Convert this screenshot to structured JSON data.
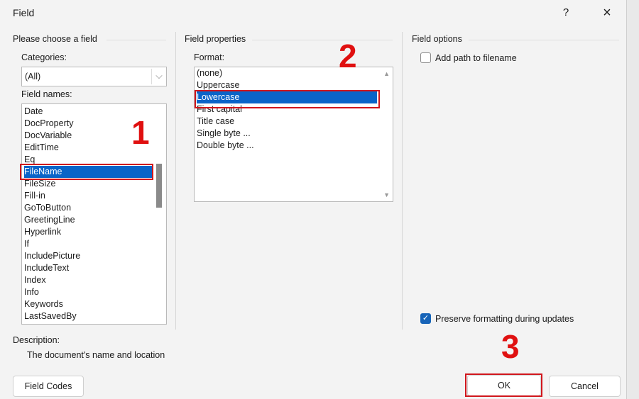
{
  "window": {
    "title": "Field",
    "help_label": "?",
    "close_label": "×"
  },
  "left": {
    "group_label": "Please choose a field",
    "categories_label": "Categories:",
    "categories_value": "(All)",
    "field_names_label": "Field names:",
    "field_names": [
      "Date",
      "DocProperty",
      "DocVariable",
      "EditTime",
      "Eq",
      "FileName",
      "FileSize",
      "Fill-in",
      "GoToButton",
      "GreetingLine",
      "Hyperlink",
      "If",
      "IncludePicture",
      "IncludeText",
      "Index",
      "Info",
      "Keywords",
      "LastSavedBy"
    ],
    "selected": "FileName"
  },
  "middle": {
    "group_label": "Field properties",
    "format_label": "Format:",
    "formats": [
      "(none)",
      "Uppercase",
      "Lowercase",
      "First capital",
      "Title case",
      "Single byte ...",
      "Double byte ..."
    ],
    "selected": "Lowercase"
  },
  "right": {
    "group_label": "Field options",
    "add_path_label": "Add path to filename",
    "add_path_checked": false,
    "preserve_label": "Preserve formatting during updates",
    "preserve_checked": true
  },
  "description": {
    "label": "Description:",
    "text": "The document's name and location"
  },
  "buttons": {
    "field_codes": "Field Codes",
    "ok": "OK",
    "cancel": "Cancel"
  },
  "annotations": {
    "step1": "1",
    "step2": "2",
    "step3": "3",
    "color": "#e01010"
  },
  "colors": {
    "selection": "#0a64c8",
    "checkbox": "#1764b8"
  }
}
